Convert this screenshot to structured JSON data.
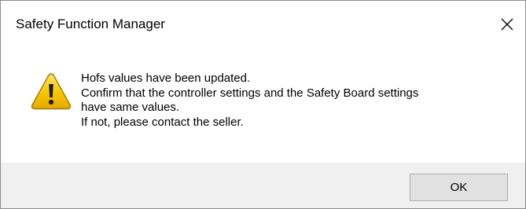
{
  "window": {
    "title": "Safety Function Manager",
    "close_icon": "close-icon"
  },
  "message": {
    "icon": "warning-icon",
    "lines": [
      "Hofs values have been updated.",
      "Confirm that the controller settings and the Safety Board settings",
      "have same values.",
      "If not, please contact the seller."
    ]
  },
  "buttons": {
    "ok_label": "OK"
  },
  "colors": {
    "content_bg": "#ffffff",
    "footer_bg": "#f0f0f0",
    "button_bg": "#e1e1e1",
    "button_border": "#adadad",
    "warning_yellow": "#f5c400",
    "warning_outline": "#9a7a00"
  }
}
